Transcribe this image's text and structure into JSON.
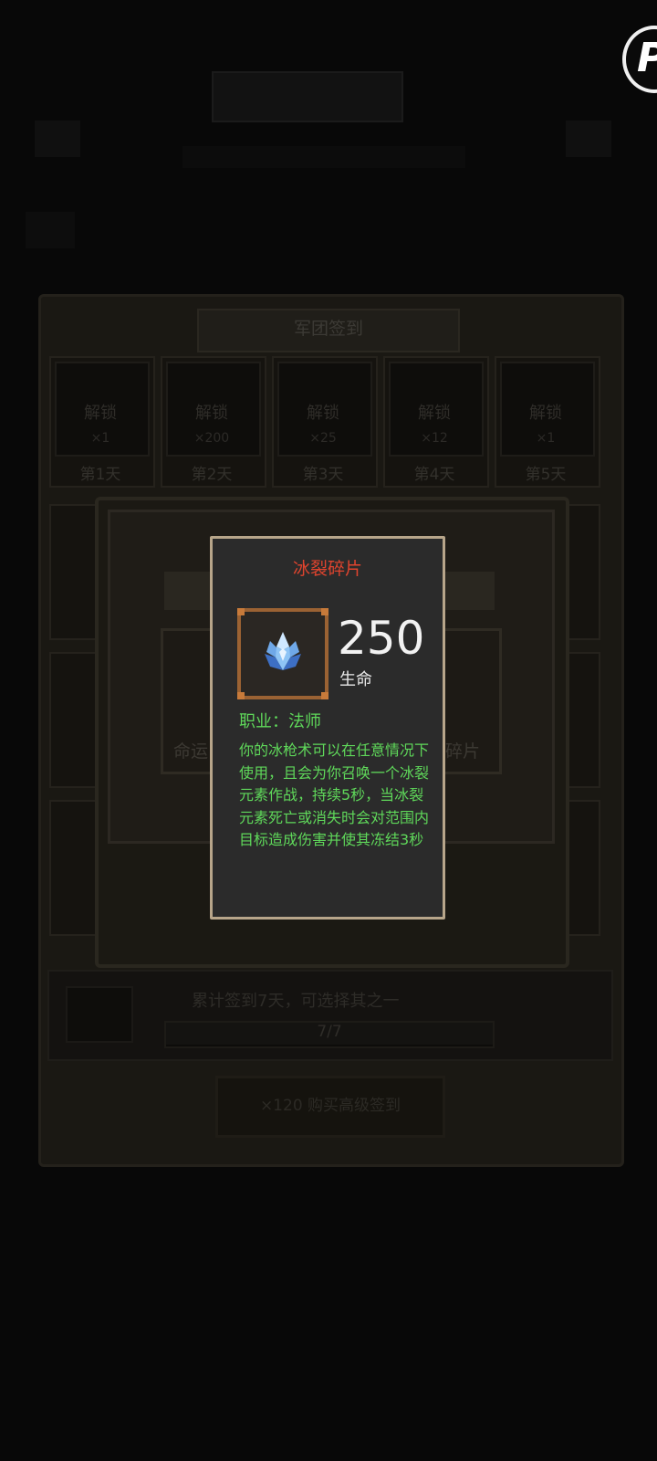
{
  "background": {
    "panel_title": "军团签到",
    "days": [
      {
        "unlock": "解锁",
        "count": "×1",
        "label": "第1天"
      },
      {
        "unlock": "解锁",
        "count": "×200",
        "label": "第2天"
      },
      {
        "unlock": "解锁",
        "count": "×25",
        "label": "第3天"
      },
      {
        "unlock": "解锁",
        "count": "×12",
        "label": "第4天"
      },
      {
        "unlock": "解锁",
        "count": "×1",
        "label": "第5天"
      }
    ],
    "mid_card_left_label": "命运",
    "mid_card_right_label": "碎片",
    "strip_text": "累计签到7天，可选择其之一",
    "progress_text": "7/7",
    "progress_fraction": 1.0,
    "buy_button": "×120 购买高级签到"
  },
  "tooltip": {
    "title": "冰裂碎片",
    "title_color": "#e0442e",
    "item_icon": "ice-crystal-icon",
    "stat_value": "250",
    "stat_label": "生命",
    "job_line": "职业：法师",
    "description": "你的冰枪术可以在任意情况下使用，且会为你召唤一个冰裂元素作战，持续5秒，当冰裂元素死亡或消失时会对范围内目标造成伤害并使其冻结3秒",
    "text_color": "#5fd85a"
  },
  "corner_logo": "P"
}
